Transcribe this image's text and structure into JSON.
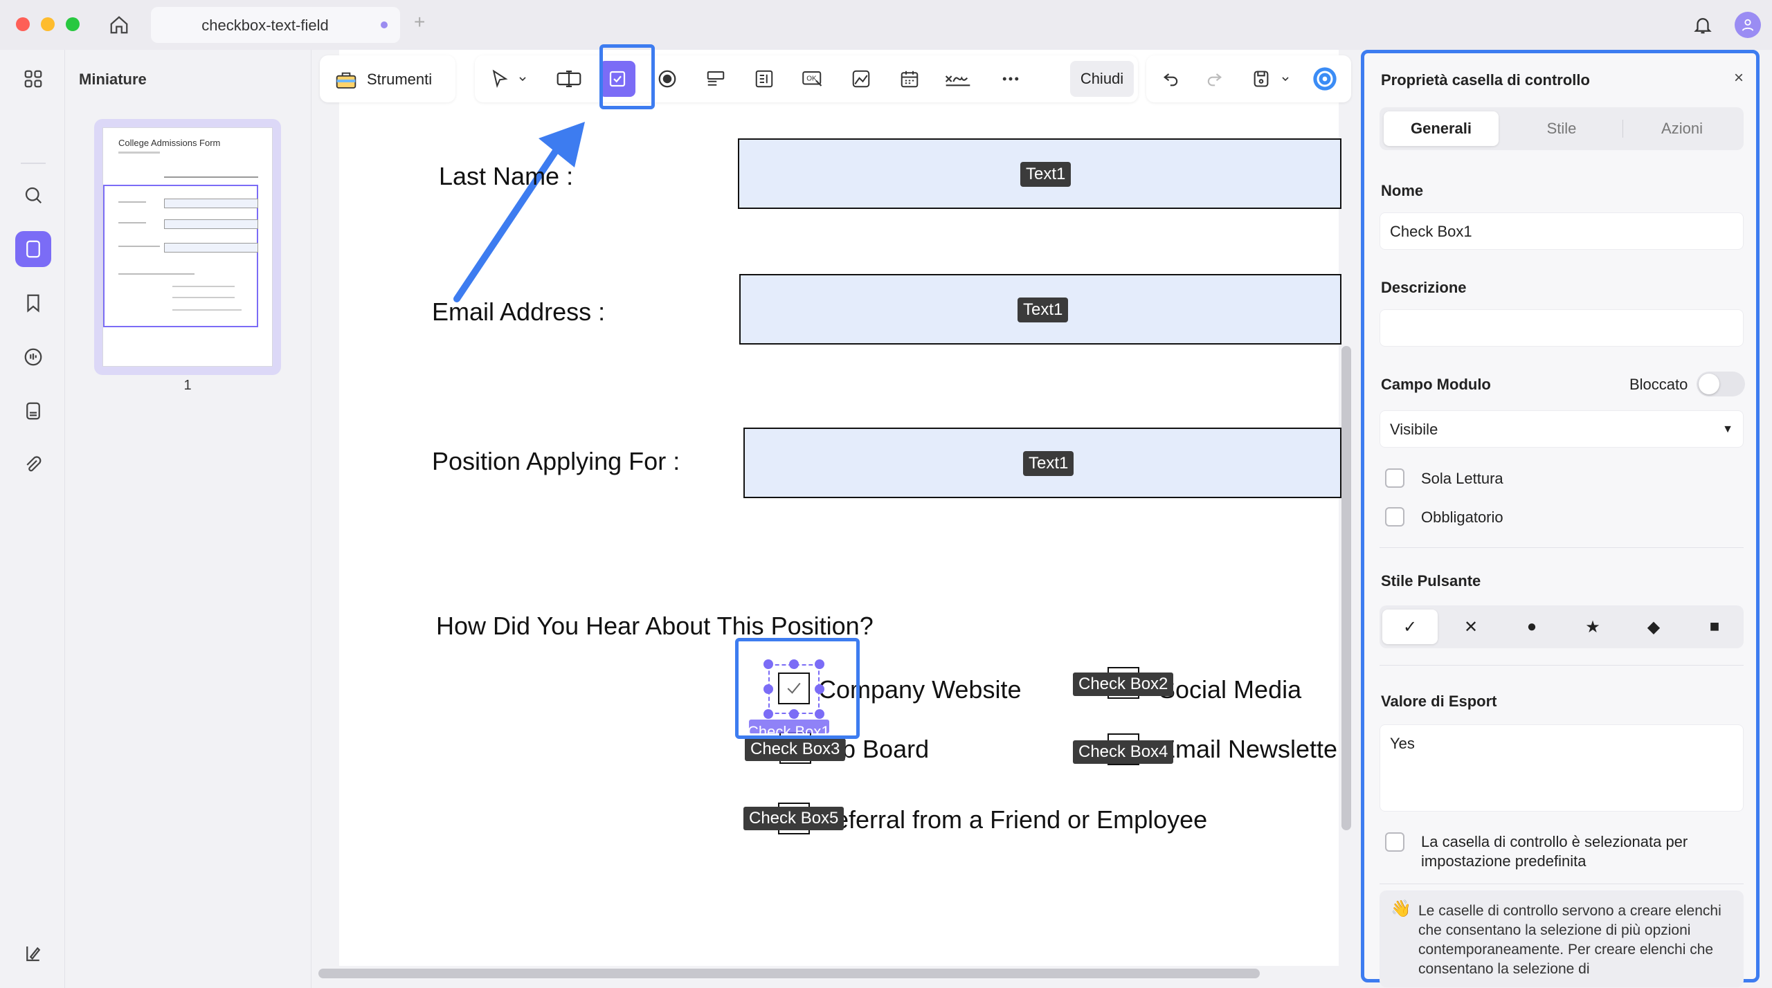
{
  "window": {
    "tab_title": "checkbox-text-field",
    "tab_add": "+"
  },
  "thumbnails": {
    "title": "Miniature",
    "page_number": "1",
    "thumb_heading": "College Admissions Form"
  },
  "toolbar": {
    "tools_label": "Strumenti",
    "close_label": "Chiudi"
  },
  "document": {
    "last_name_label": "Last Name :",
    "email_label": "Email Address :",
    "position_label": "Position Applying For :",
    "text_field_tag": "Text1",
    "question": "How Did You Hear About This Position?",
    "options": [
      {
        "tag": "Check Box1",
        "text": "Company Website"
      },
      {
        "tag": "Check Box2",
        "text": "Social Media"
      },
      {
        "tag": "Check Box3",
        "text": "Job Board"
      },
      {
        "tag": "Check Box4",
        "text": "Email Newslette"
      },
      {
        "tag": "Check Box5",
        "text": "Referral from a Friend or Employee"
      }
    ]
  },
  "panel": {
    "title": "Proprietà casella di controllo",
    "close": "×",
    "tabs": [
      "Generali",
      "Stile",
      "Azioni"
    ],
    "name_label": "Nome",
    "name_value": "Check Box1",
    "description_label": "Descrizione",
    "description_value": "",
    "form_field_label": "Campo Modulo",
    "locked_label": "Bloccato",
    "visibility_value": "Visibile",
    "read_only_label": "Sola Lettura",
    "required_label": "Obbligatorio",
    "button_style_label": "Stile Pulsante",
    "button_styles": [
      "✓",
      "✕",
      "●",
      "★",
      "◆",
      "■"
    ],
    "export_value_label": "Valore di Esport",
    "export_value": "Yes",
    "default_checked_label": "La casella di controllo è selezionata per impostazione predefinita",
    "info_icon": "👋",
    "info_text": "Le caselle di controllo servono a creare elenchi che consentano la selezione di più opzioni contemporaneamente. Per creare elenchi che consentano la selezione di"
  },
  "colors": {
    "accent": "#7b6cf6",
    "highlight": "#3d7cf0",
    "field_fill": "#e4ecfb"
  }
}
